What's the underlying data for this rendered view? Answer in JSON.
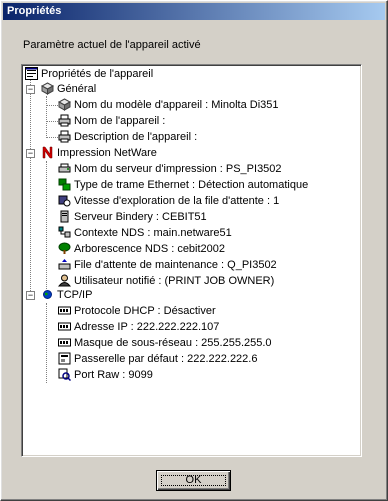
{
  "window": {
    "title": "Propriétés"
  },
  "subtitle": "Paramètre actuel de l'appareil activé",
  "tree": {
    "root": "Propriétés de l'appareil",
    "general": {
      "label": "Général",
      "items": [
        "Nom du modèle d'appareil : Minolta Di351",
        "Nom de l'appareil :",
        "Description de l'appareil :"
      ]
    },
    "netware": {
      "label": "Impression NetWare",
      "items": [
        "Nom du serveur d'impression : PS_PI3502",
        "Type de trame Ethernet : Détection automatique",
        "Vitesse d'exploration de la file d'attente : 1",
        "Serveur Bindery : CEBIT51",
        "Contexte NDS : main.netware51",
        "Arborescence NDS : cebit2002",
        "File d'attente de maintenance : Q_PI3502",
        "Utilisateur notifié : (PRINT JOB OWNER)"
      ]
    },
    "tcpip": {
      "label": "TCP/IP",
      "items": [
        "Protocole DHCP : Désactiver",
        "Adresse IP : 222.222.222.107",
        "Masque de sous-réseau : 255.255.255.0",
        "Passerelle par défaut : 222.222.222.6",
        "Port Raw : 9099"
      ]
    }
  },
  "buttons": {
    "ok": "OK"
  }
}
